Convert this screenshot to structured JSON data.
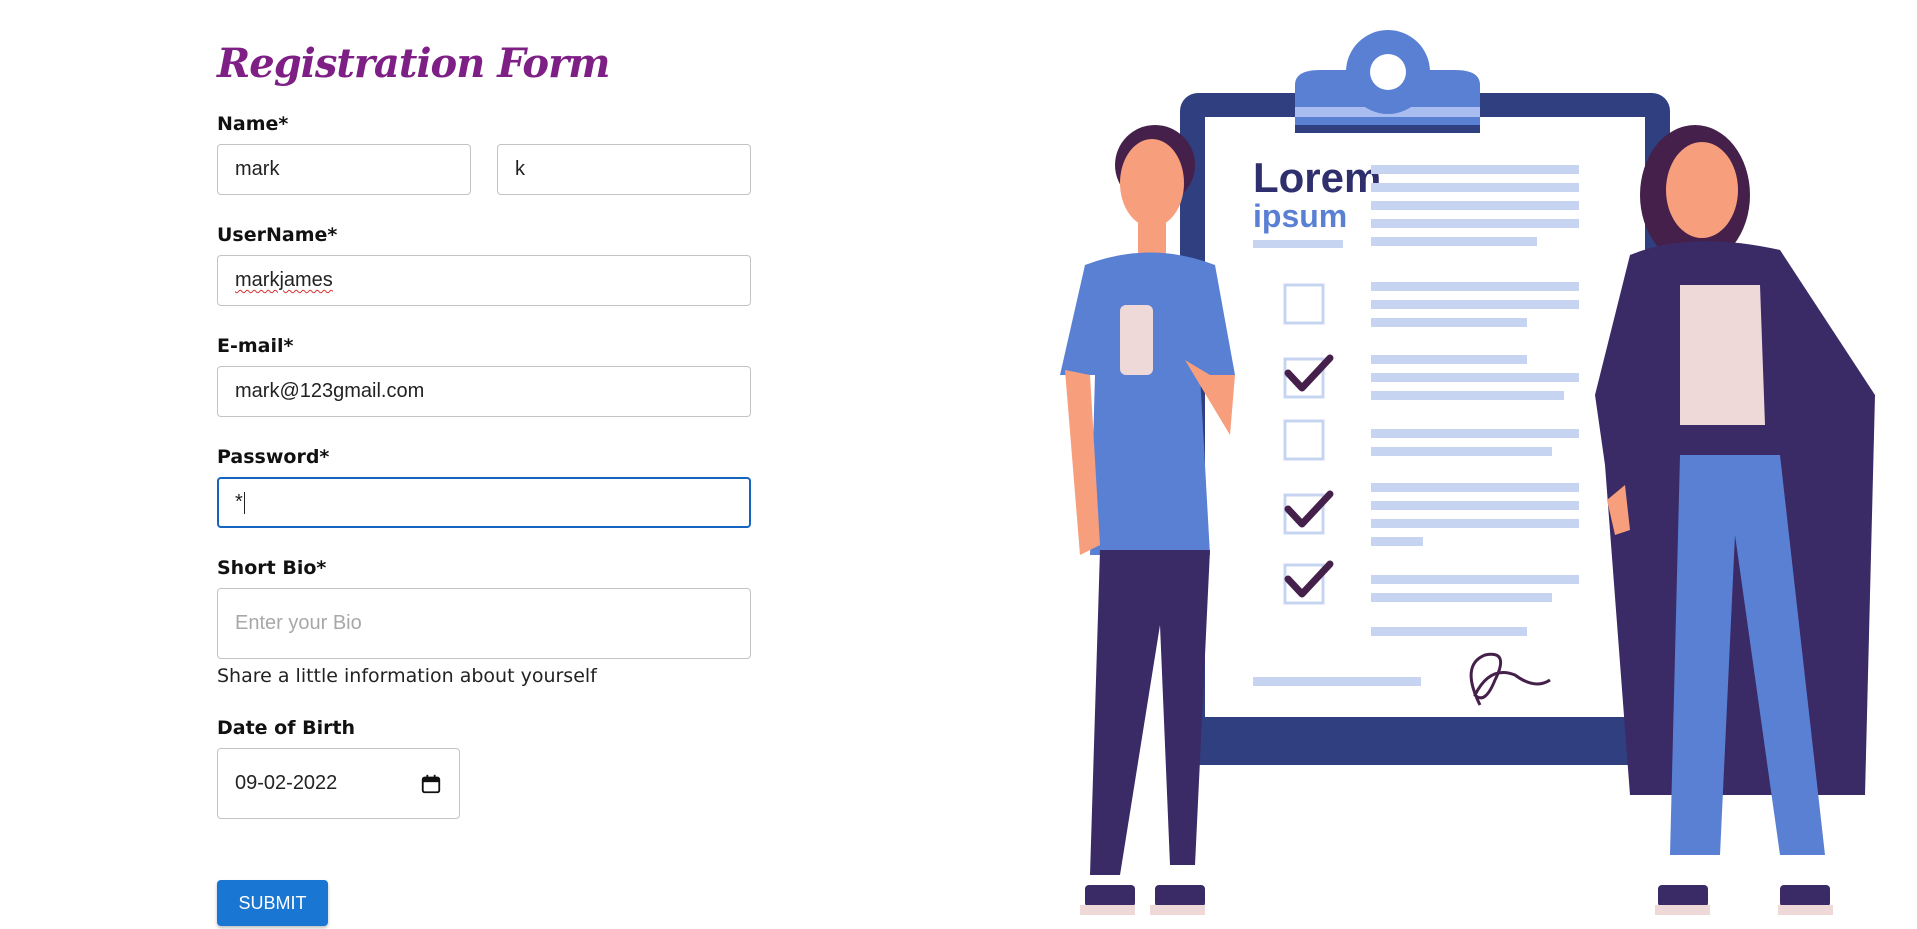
{
  "form": {
    "title": "Registration Form",
    "name_label": "Name*",
    "first_name_value": "mark",
    "last_name_value": "k",
    "username_label": "UserName*",
    "username_value": "markjames",
    "email_label": "E-mail*",
    "email_value": "mark@123gmail.com",
    "password_label": "Password*",
    "password_value": "*",
    "bio_label": "Short Bio*",
    "bio_placeholder": "Enter your Bio",
    "bio_helper": "Share a little information about yourself",
    "dob_label": "Date of Birth",
    "dob_value": "09-02-2022",
    "submit_label": "SUBMIT"
  },
  "illustration": {
    "heading_line1": "Lorem",
    "heading_line2": "ipsum"
  },
  "icons": {
    "calendar": "calendar-icon"
  },
  "colors": {
    "title": "#7e1f86",
    "button": "#1976d2",
    "focus_border": "#1565c0"
  }
}
